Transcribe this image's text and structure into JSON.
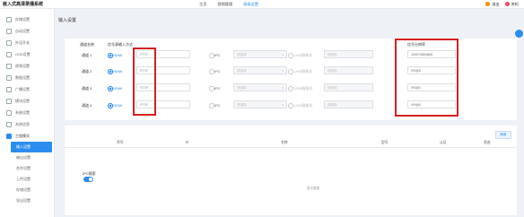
{
  "app": {
    "title": "嵌入式高清录播系统",
    "nav": [
      "主页",
      "视频管理",
      "高级设置"
    ],
    "nav_active_index": 2,
    "user": "退出",
    "extra": "关机"
  },
  "sidebar": {
    "items": [
      "存储设置",
      "自动设置",
      "外设开关",
      "OSD设置",
      "视频设置",
      "数据设置",
      "广播设置",
      "模块设置",
      "系统设置",
      "系统信息"
    ],
    "section": "工程模式",
    "subitems": [
      "输入设置",
      "输出设置",
      "合并设置",
      "上传设置",
      "存储设置",
      "导出设置"
    ],
    "active_sub": "输入设置"
  },
  "page": {
    "title": "输入设置"
  },
  "input_table": {
    "headers": {
      "channel": "通道名称",
      "mode": "信号源输入方式",
      "ip": "信号分辨率"
    },
    "radio_hdmi": "HDMI",
    "radio_ipc": "IPC",
    "radio_cam": "USB摄像机",
    "select_placeholder": "请选择",
    "rows": [
      {
        "name": "通道 1",
        "res": "1920*1080@60",
        "field": "RTSP"
      },
      {
        "name": "通道 2",
        "res": "0*0@0",
        "field": "RTSP"
      },
      {
        "name": "通道 3",
        "res": "0*0@0",
        "field": "RTSP"
      },
      {
        "name": "通道 4",
        "res": "0*0@0",
        "field": "RTSP"
      }
    ]
  },
  "ipc_table": {
    "refresh": "刷新",
    "headers": [
      "序号",
      "IP",
      "名称",
      "型号",
      "认证",
      "状态"
    ],
    "ipc_label": "IPC搜索",
    "toggle_on": true,
    "empty_text": "暂无数据"
  },
  "colors": {
    "accent": "#2d8cf0",
    "highlight": "#d71f1f"
  }
}
